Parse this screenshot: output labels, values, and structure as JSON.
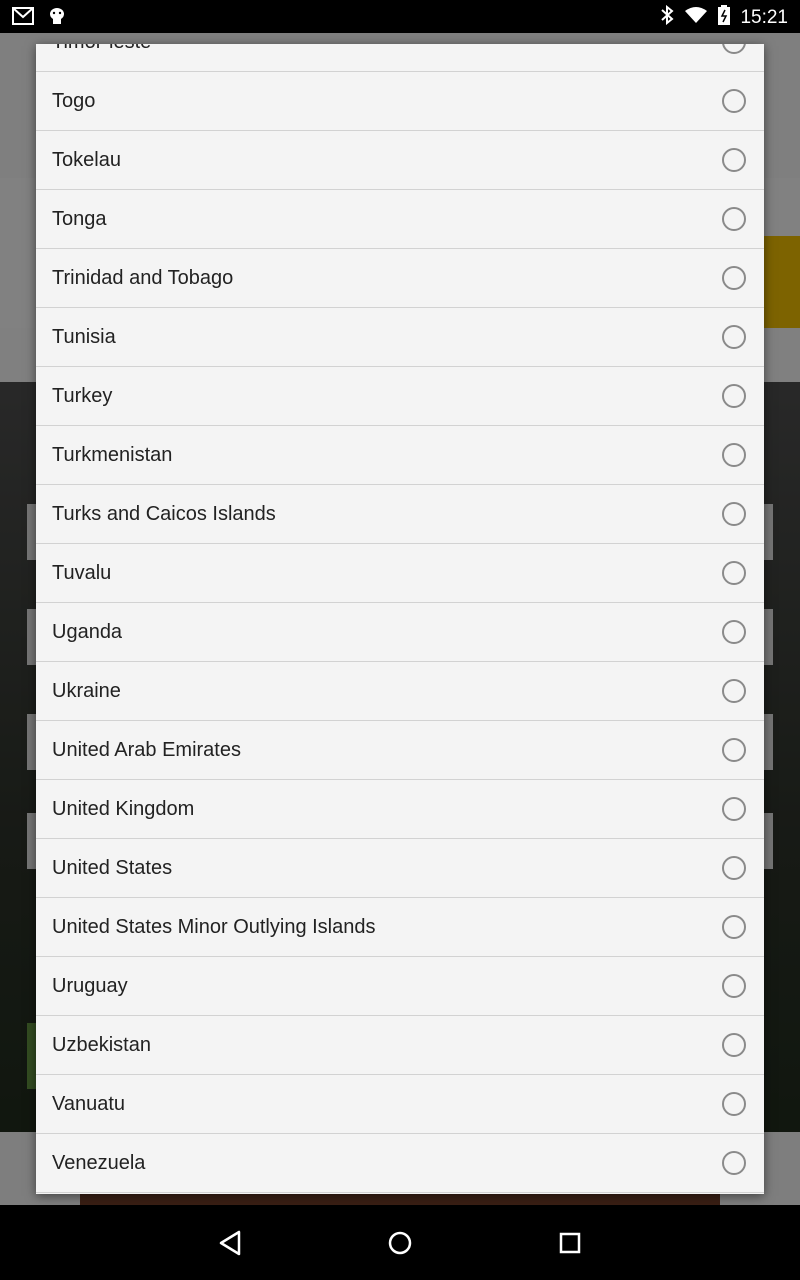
{
  "status_bar": {
    "time": "15:21",
    "icons": [
      "gmail-icon",
      "android-debug-icon",
      "bluetooth-icon",
      "wifi-icon",
      "battery-charging-icon"
    ]
  },
  "dialog": {
    "options": [
      {
        "label": "Timor-leste",
        "selected": false
      },
      {
        "label": "Togo",
        "selected": false
      },
      {
        "label": "Tokelau",
        "selected": false
      },
      {
        "label": "Tonga",
        "selected": false
      },
      {
        "label": "Trinidad and Tobago",
        "selected": false
      },
      {
        "label": "Tunisia",
        "selected": false
      },
      {
        "label": "Turkey",
        "selected": false
      },
      {
        "label": "Turkmenistan",
        "selected": false
      },
      {
        "label": "Turks and Caicos Islands",
        "selected": false
      },
      {
        "label": "Tuvalu",
        "selected": false
      },
      {
        "label": "Uganda",
        "selected": false
      },
      {
        "label": "Ukraine",
        "selected": false
      },
      {
        "label": "United Arab Emirates",
        "selected": false
      },
      {
        "label": "United Kingdom",
        "selected": false
      },
      {
        "label": "United States",
        "selected": false
      },
      {
        "label": "United States Minor Outlying Islands",
        "selected": false
      },
      {
        "label": "Uruguay",
        "selected": false
      },
      {
        "label": "Uzbekistan",
        "selected": false
      },
      {
        "label": "Vanuatu",
        "selected": false
      },
      {
        "label": "Venezuela",
        "selected": false
      }
    ]
  },
  "nav_bar": {
    "buttons": [
      "back-icon",
      "home-icon",
      "recent-apps-icon"
    ]
  },
  "colors": {
    "dialog_bg": "#f4f4f4",
    "divider": "#d2d2d2",
    "radio_border": "#8a8a8a",
    "text": "#222222"
  }
}
